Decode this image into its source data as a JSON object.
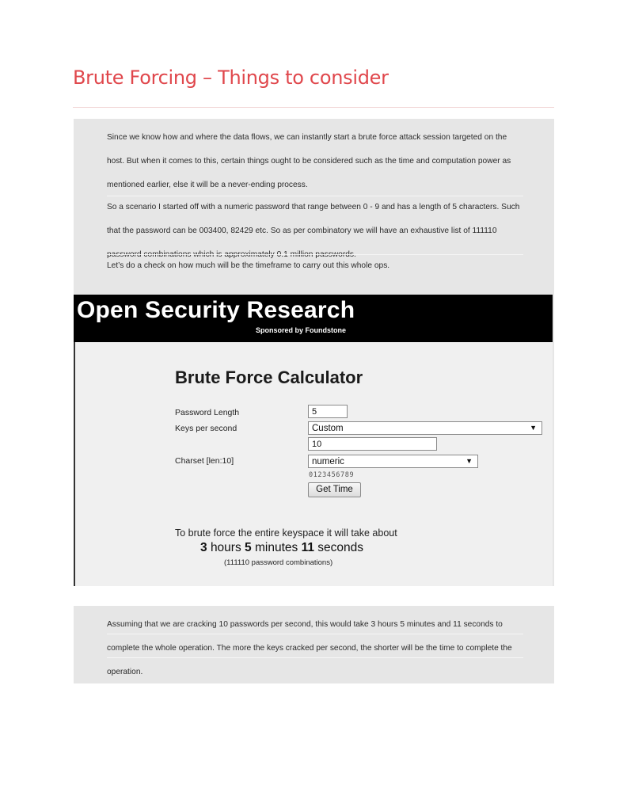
{
  "heading": "Brute Forcing – Things to consider",
  "intro_paragraphs": [
    "Since we know how and where the data flows, we can instantly start a brute force attack session targeted on the host. But when it comes to this, certain things ought to be considered such as the time and computation power as mentioned earlier, else it will be a never-ending process.",
    "So a scenario I started off with a numeric password that range between 0 - 9 and has a length of 5 characters. Such that the password can be 003400, 82429 etc. So as per combinatory we will have an exhaustive list of 111110 password combinations which is approximately 0.1 million passwords.",
    "Let’s do a check on how much will be the timeframe to carry out this whole ops."
  ],
  "screenshot": {
    "banner_title": "Open Security Research",
    "banner_subtitle": "Sponsored by Foundstone",
    "calculator_title": "Brute Force Calculator",
    "labels": {
      "password_length": "Password Length",
      "keys_per_second": "Keys per second",
      "charset": "Charset [len:10]"
    },
    "values": {
      "password_length": "5",
      "keys_per_second_select": "Custom",
      "keys_per_second_custom": "10",
      "charset_select": "numeric",
      "charset_preview": "0123456789"
    },
    "button_label": "Get Time",
    "result_lead": "To brute force the entire keyspace it will take about",
    "result_hours": "3",
    "result_hours_unit": "hours",
    "result_minutes": "5",
    "result_minutes_unit": "minutes",
    "result_seconds": "11",
    "result_seconds_unit": "seconds",
    "result_combinations": "(111110 password combinations)"
  },
  "closing_paragraph": "Assuming that we are cracking 10 passwords per second, this would take 3 hours 5 minutes and 11 seconds to complete the whole operation. The more the keys cracked per second, the shorter will be the time to complete the operation.",
  "icons": {
    "dropdown_arrow": "▼"
  },
  "colors": {
    "heading": "#e0474c",
    "panel": "#e6e6e6",
    "banner": "#000000"
  }
}
